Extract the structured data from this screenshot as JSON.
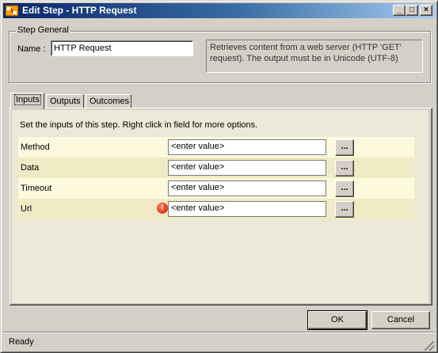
{
  "window": {
    "title": "Edit Step - HTTP Request",
    "controls": {
      "minimize": "_",
      "maximize": "□",
      "close": "×"
    }
  },
  "step_general": {
    "group_title": "Step General",
    "name_label": "Name :",
    "name_value": "HTTP Request",
    "description": "Retrieves content from a web server (HTTP 'GET' request). The output must be in Unicode (UTF-8)"
  },
  "tabs": [
    "Inputs",
    "Outputs",
    "Outcomes"
  ],
  "inputs_panel": {
    "instructions": "Set the inputs of this step.  Right click in field for more options.",
    "rows": [
      {
        "label": "Method",
        "value": "<enter value>",
        "button": "...",
        "error": false
      },
      {
        "label": "Data",
        "value": "<enter value>",
        "button": "...",
        "error": false
      },
      {
        "label": "Timeout",
        "value": "<enter value>",
        "button": "...",
        "error": false
      },
      {
        "label": "Url",
        "value": "<enter value>",
        "button": "...",
        "error": true,
        "error_glyph": "!"
      }
    ]
  },
  "buttons": {
    "ok": "OK",
    "cancel": "Cancel"
  },
  "status": "Ready",
  "icons": [
    "app-icon",
    "error-icon",
    "resize-grip-icon"
  ]
}
